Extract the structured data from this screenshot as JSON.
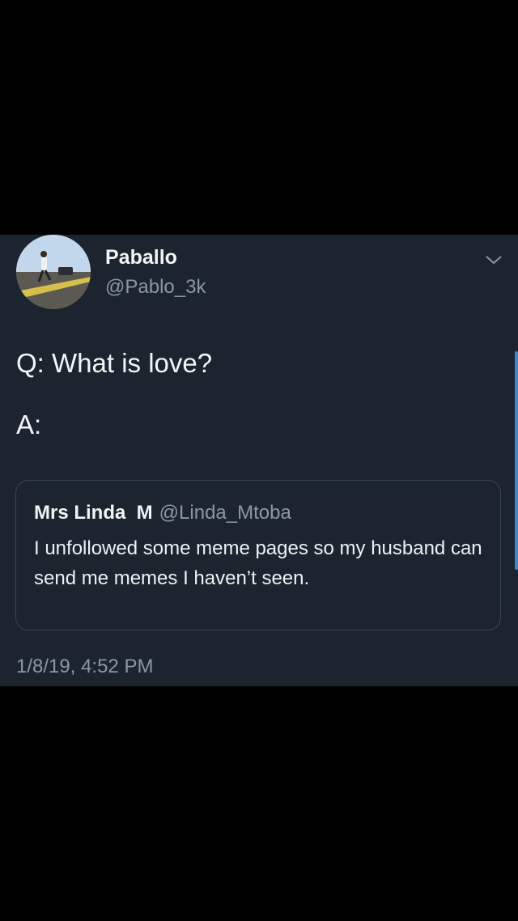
{
  "tweet": {
    "author": {
      "display_name": "Paballo",
      "handle": "@Pablo_3k",
      "avatar_icon": "profile-photo"
    },
    "menu_icon": "chevron-down-icon",
    "text_lines": [
      "Q: What is love?",
      "A:"
    ],
    "quoted_tweet": {
      "display_name": "Mrs Linda  M",
      "handle": "@Linda_Mtoba",
      "text": "I unfollowed some meme pages so my husband can send me memes I haven’t seen."
    },
    "timestamp": "1/8/19, 4:52 PM"
  },
  "colors": {
    "card_background": "#1c2430",
    "page_background": "#000000",
    "primary_text": "#f2f4f6",
    "secondary_text": "#8a98a6",
    "accent": "#3d87d1"
  }
}
